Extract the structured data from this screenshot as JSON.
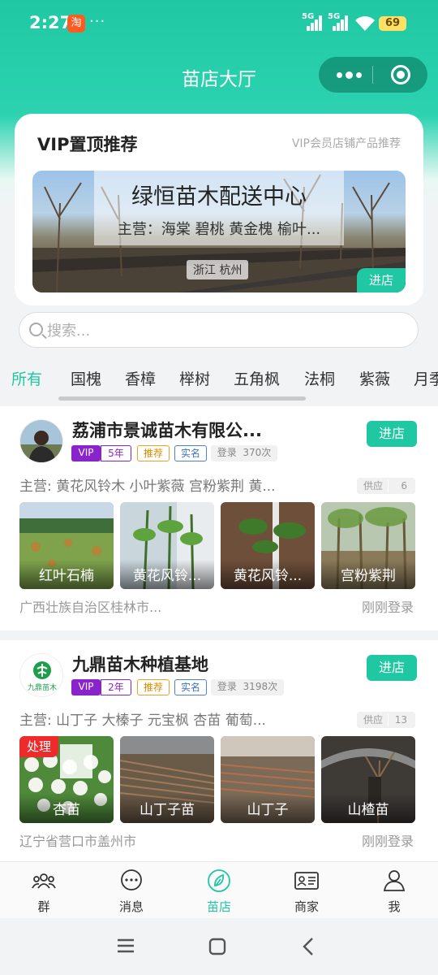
{
  "status_bar": {
    "time": "2:27",
    "taobao_glyph": "淘",
    "dots": "···",
    "sig1": "5G",
    "sig2": "5G",
    "battery": "69"
  },
  "nav": {
    "title": "苗店大厅"
  },
  "vip": {
    "title": "VIP置顶推荐",
    "subtitle": "VIP会员店铺产品推荐",
    "banner": {
      "name": "绿恒苗木配送中心",
      "main": "主营：海棠 碧桃 黄金槐 榆叶...",
      "location": "浙江 杭州",
      "enter": "进店"
    }
  },
  "search": {
    "placeholder": "搜索..."
  },
  "categories": [
    "所有",
    "国槐",
    "香樟",
    "榉树",
    "五角枫",
    "法桐",
    "紫薇",
    "月季"
  ],
  "categories_active": 0,
  "shops": [
    {
      "name": "荔浦市景诚苗木有限公...",
      "vip": "VIP",
      "years": "5年",
      "recommend": "推荐",
      "verified": "实名",
      "login_label": "登录",
      "login_count": "370次",
      "enter": "进店",
      "main": "主营: 黄花风铃木 小叶紫薇 宫粉紫荆 黄...",
      "supply_label": "供应",
      "supply_count": "6",
      "products": [
        "红叶石楠",
        "黄花风铃...",
        "黄花风铃...",
        "宫粉紫荆"
      ],
      "location": "广西壮族自治区桂林市...",
      "last_login": "刚刚登录"
    },
    {
      "name": "九鼎苗木种植基地",
      "vip": "VIP",
      "years": "2年",
      "recommend": "推荐",
      "verified": "实名",
      "login_label": "登录",
      "login_count": "3198次",
      "enter": "进店",
      "main": "主营: 山丁子 大榛子 元宝枫 杏苗 葡萄...",
      "supply_label": "供应",
      "supply_count": "13",
      "products": [
        "杏苗",
        "山丁子苗",
        "山丁子",
        "山楂苗"
      ],
      "product_tag": "处理",
      "logo_text": "九鼎苗木",
      "location": "辽宁省营口市盖州市",
      "last_login": "刚刚登录"
    }
  ],
  "tabbar": [
    {
      "label": "群",
      "icon": "group-icon"
    },
    {
      "label": "消息",
      "icon": "message-icon"
    },
    {
      "label": "苗店",
      "icon": "leaf-icon"
    },
    {
      "label": "商家",
      "icon": "merchant-card-icon"
    },
    {
      "label": "我",
      "icon": "person-icon"
    }
  ],
  "tabbar_active": 2,
  "colors": {
    "accent": "#1fc8a3",
    "vip": "#8a23cc",
    "recommend": "#f0a020",
    "verified": "#4a82d8"
  }
}
